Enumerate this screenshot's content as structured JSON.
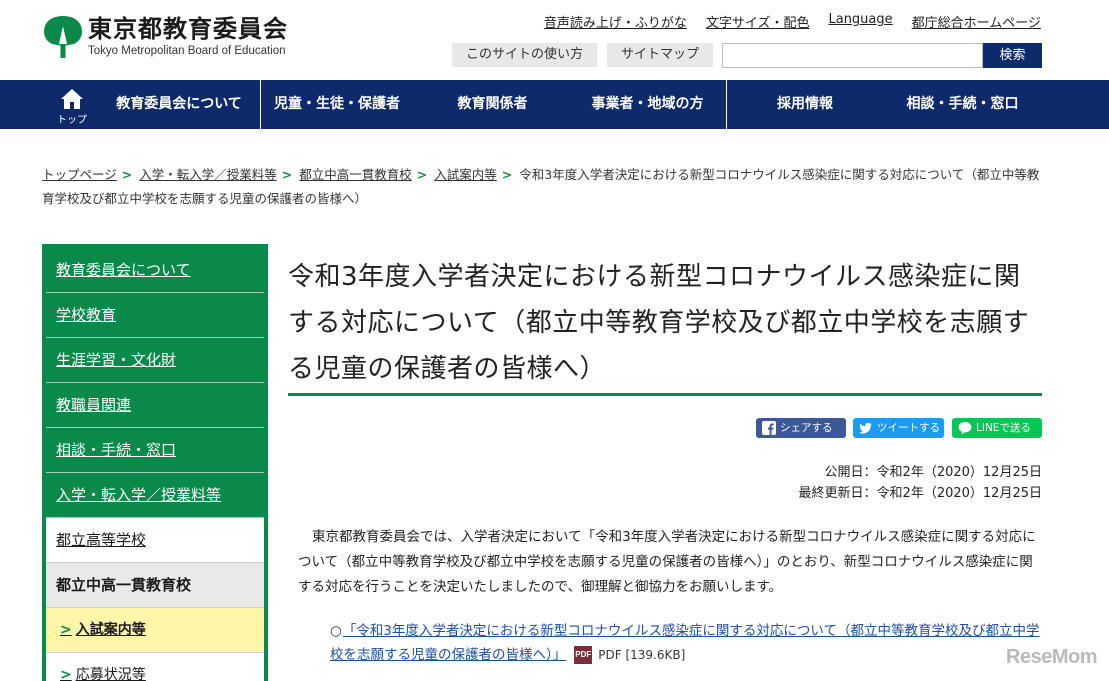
{
  "header": {
    "logo_ja": "東京都教育委員会",
    "logo_en": "Tokyo Metropolitan Board of Education",
    "top_links": [
      "音声読み上げ・ふりがな",
      "文字サイズ・配色",
      "Language",
      "都庁総合ホームページ"
    ],
    "sub_buttons": [
      "このサイトの使い方",
      "サイトマップ"
    ],
    "search": {
      "placeholder": "",
      "button_label": "検索"
    }
  },
  "gnav": {
    "home_label": "トップ",
    "items": [
      "教育委員会について",
      "児童・生徒・保護者",
      "教育関係者",
      "事業者・地域の方",
      "採用情報",
      "相談・手続・窓口"
    ]
  },
  "breadcrumb": {
    "items": [
      "トップページ",
      "入学・転入学／授業料等",
      "都立中高一貫教育校",
      "入試案内等"
    ],
    "current": "令和3年度入学者決定における新型コロナウイルス感染症に関する対応について（都立中等教育学校及び都立中学校を志願する児童の保護者の皆様へ）"
  },
  "sidemenu": {
    "items": [
      "教育委員会について",
      "学校教育",
      "生涯学習・文化財",
      "教職員関連",
      "相談・手続・窓口",
      "入学・転入学／授業料等"
    ],
    "sub_items": [
      "都立高等学校",
      "都立中高一貫教育校",
      "入試案内等",
      "応募状況等"
    ]
  },
  "main": {
    "title": "令和3年度入学者決定における新型コロナウイルス感染症に関する対応について（都立中等教育学校及び都立中学校を志願する児童の保護者の皆様へ）",
    "share": {
      "facebook": "シェアする",
      "twitter": "ツイートする",
      "line": "LINEで送る"
    },
    "published": "公開日：令和2年（2020）12月25日",
    "updated": "最終更新日：令和2年（2020）12月25日",
    "body": "東京都教育委員会では、入学者決定において「令和3年度入学者決定における新型コロナウイルス感染症に関する対応について（都立中等教育学校及び都立中学校を志願する児童の保護者の皆様へ）」のとおり、新型コロナウイルス感染症に関する対応を行うことを決定いたしましたので、御理解と御協力をお願いします。",
    "doc_link": {
      "bullet": "○",
      "text": "「令和3年度入学者決定における新型コロナウイルス感染症に関する対応について（都立中等教育学校及び都立中学校を志願する児童の保護者の皆様へ）」",
      "file_type": "PDF",
      "size": "PDF [139.6KB]"
    }
  },
  "watermark": "ReseMom",
  "colors": {
    "navy": "#0e2a6a",
    "green": "#0a8a4a",
    "link": "#1f4ea3"
  }
}
